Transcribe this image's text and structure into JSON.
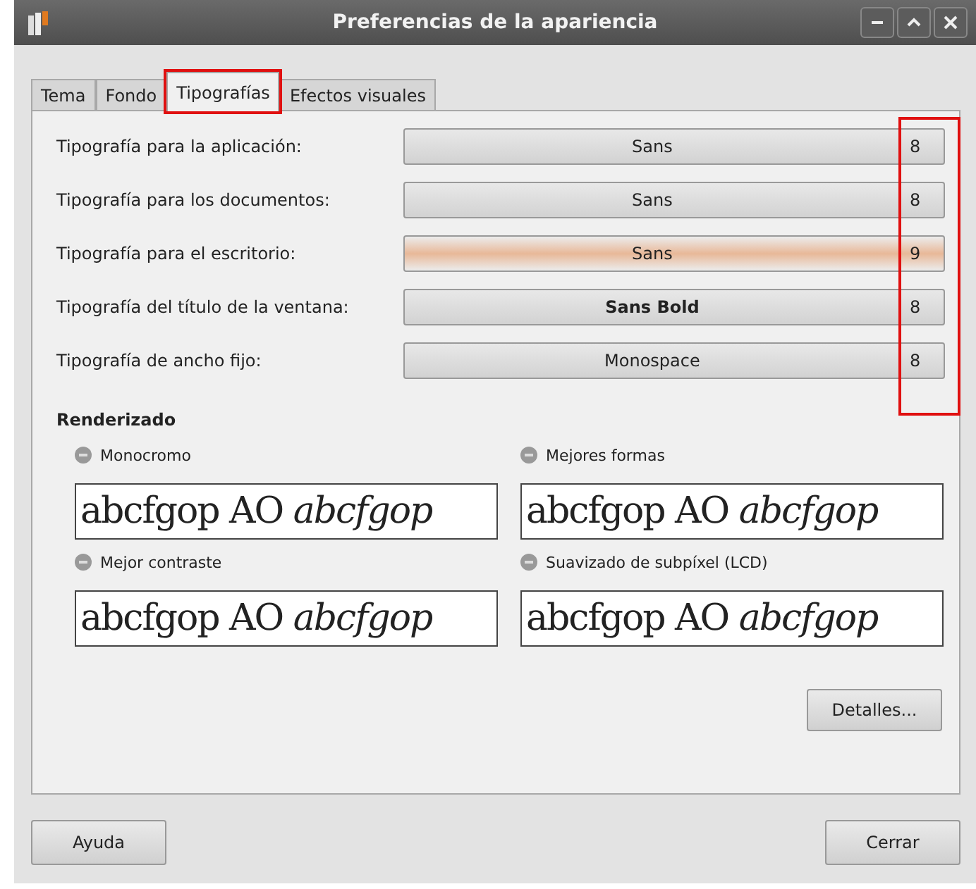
{
  "window": {
    "title": "Preferencias de la apariencia"
  },
  "tabs": [
    {
      "label": "Tema",
      "selected": false,
      "highlighted": false
    },
    {
      "label": "Fondo",
      "selected": false,
      "highlighted": false
    },
    {
      "label": "Tipografías",
      "selected": true,
      "highlighted": true
    },
    {
      "label": "Efectos visuales",
      "selected": false,
      "highlighted": false
    }
  ],
  "font_rows": [
    {
      "label": "Tipografía para la aplicación:",
      "font": "Sans",
      "size": "8",
      "bold": false,
      "hover": false
    },
    {
      "label": "Tipografía para los documentos:",
      "font": "Sans",
      "size": "8",
      "bold": false,
      "hover": false
    },
    {
      "label": "Tipografía para el escritorio:",
      "font": "Sans",
      "size": "9",
      "bold": false,
      "hover": true
    },
    {
      "label": "Tipografía del título de la ventana:",
      "font": "Sans Bold",
      "size": "8",
      "bold": true,
      "hover": false
    },
    {
      "label": "Tipografía de ancho fijo:",
      "font": "Monospace",
      "size": "8",
      "bold": false,
      "hover": false
    }
  ],
  "sizes_highlighted": true,
  "rendering": {
    "title": "Renderizado",
    "options": [
      {
        "label": "Monocromo",
        "selected": false,
        "sample": "abcfgop AO *abcfgop*"
      },
      {
        "label": "Mejores formas",
        "selected": false,
        "sample": "abcfgop AO *abcfgop*"
      },
      {
        "label": "Mejor contraste",
        "selected": false,
        "sample": "abcfgop AO *abcfgop*"
      },
      {
        "label": "Suavizado de subpíxel (LCD)",
        "selected": false,
        "sample": "abcfgop AO *abcfgop*"
      }
    ]
  },
  "details_button": "Detalles...",
  "buttons": {
    "help": "Ayuda",
    "close": "Cerrar"
  }
}
